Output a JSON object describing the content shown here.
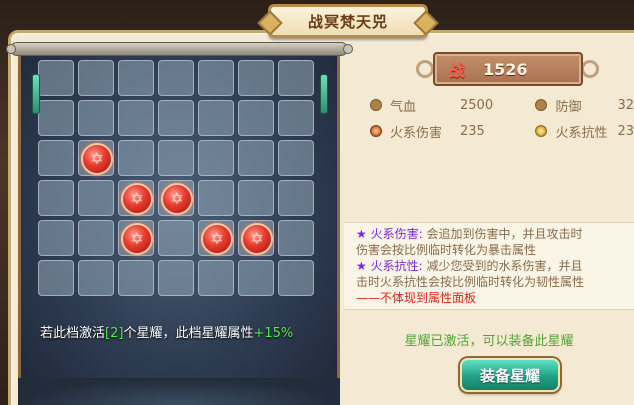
{
  "window": {
    "title": "战冥梵天兕"
  },
  "board": {
    "columns": 7,
    "rows": 6,
    "active_cells": [
      [
        2,
        1
      ],
      [
        3,
        2
      ],
      [
        3,
        3
      ],
      [
        4,
        2
      ],
      [
        4,
        4
      ],
      [
        4,
        5
      ]
    ],
    "caption": {
      "prefix": "若此档激活",
      "count_bracket": "[2]",
      "middle": "个星耀，此档星耀属性",
      "bonus": "+15%"
    }
  },
  "power": {
    "label": "战",
    "value": "1526"
  },
  "stats": {
    "row1": [
      {
        "icon": "drop-icon",
        "label": "气血",
        "value": "2500"
      },
      {
        "icon": "shield-icon",
        "label": "防御",
        "value": "32"
      }
    ],
    "row2": [
      {
        "icon": "fire-icon",
        "label": "火系伤害",
        "value": "235"
      },
      {
        "icon": "fire-resist-icon",
        "label": "火系抗性",
        "value": "23"
      }
    ]
  },
  "description": {
    "line1_title": "★ 火系伤害:",
    "line1_text": " 会追加到伤害中，并且攻击时",
    "line2_text": "伤害会按比例临时转化为暴击属性",
    "line3_title": "★ 火系抗性:",
    "line3_text": " 减少您受到的水系伤害，并且",
    "line4_text": "击时火系抗性会按比例临时转化为韧性属性",
    "line5_note": "——不体现到属性面板"
  },
  "status_message": "星耀已激活，可以装备此星耀",
  "equip_button": {
    "label": "装备星耀"
  },
  "colors": {
    "accent_green": "#21a184",
    "gem_red": "#e53a2c",
    "panel_parchment": "#f4ead3",
    "status_green": "#53a335"
  }
}
